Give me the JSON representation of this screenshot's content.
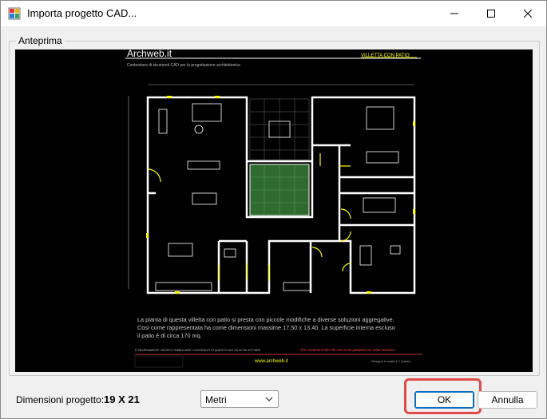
{
  "window": {
    "title": "Importa progetto CAD...",
    "icon": "app-icon"
  },
  "preview_group": {
    "label": "Anteprima"
  },
  "drawing": {
    "brand": "Archweb.it",
    "tag": "VILLETTA CON PATIO",
    "subtitle": "Contenitore di strumenti CAD per la progettazione architettonica",
    "description_line1": "La pianta di questa villetta con patio si presta con piccole modifiche a diverse soluzioni aggregative.",
    "description_line2": "Così come rappresentata ha come dimensioni massime 17.50 x 13.40. La superficie interna escluso",
    "description_line3": "il patio è di circa 170 mq.",
    "legal_left": "È SEVERAMENTE VIETATO PUBBLICARE I CONTENUTI DI QUESTO FILE SU ALTRI SITI WEB",
    "legal_right": "The contents of this file cannot be published on other websites",
    "footer_url": "www.archweb.it",
    "footer_scale": "Disegno in scala 1:1 (metri)"
  },
  "footer": {
    "dimensions_label": "Dimensioni progetto:",
    "dimensions_value": "19 X 21",
    "unit_selected": "Metri",
    "ok_label": "OK",
    "cancel_label": "Annulla"
  },
  "colors": {
    "highlight": "#e04a4a",
    "ok_border": "#0f6cbd",
    "cad_wall": "#ffffff",
    "cad_door": "#ffff00",
    "cad_accent": "#ff4040",
    "patio": "#3a7a3a"
  }
}
